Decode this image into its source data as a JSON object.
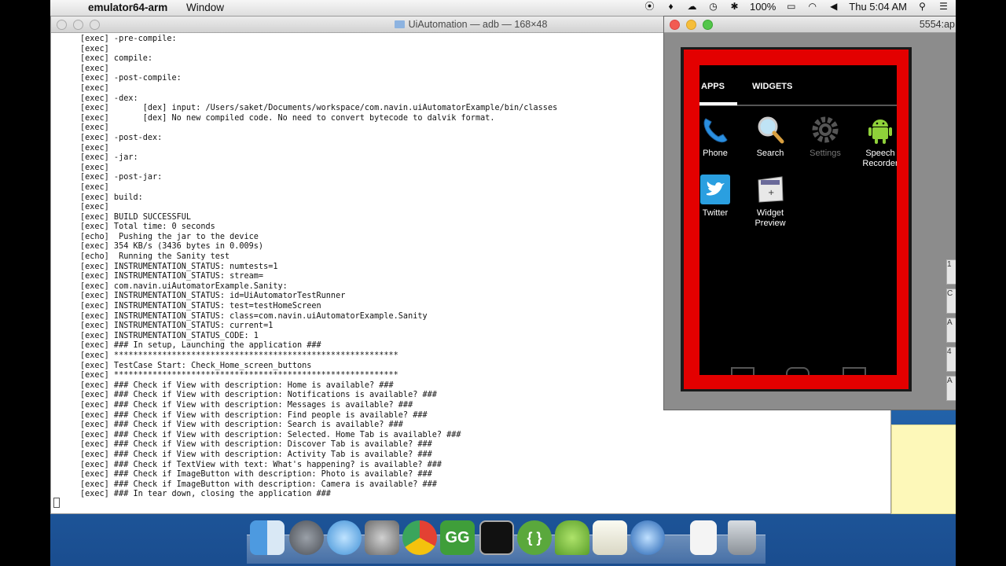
{
  "menubar": {
    "app_name": "emulator64-arm",
    "menu_window": "Window",
    "battery": "100%",
    "clock": "Thu 5:04 AM"
  },
  "terminal": {
    "title": "UiAutomation — adb — 168×48",
    "log": [
      "[exec] -pre-compile:",
      "[exec]",
      "[exec] compile:",
      "[exec]",
      "[exec] -post-compile:",
      "[exec]",
      "[exec] -dex:",
      "[exec]       [dex] input: /Users/saket/Documents/workspace/com.navin.uiAutomatorExample/bin/classes",
      "[exec]       [dex] No new compiled code. No need to convert bytecode to dalvik format.",
      "[exec]",
      "[exec] -post-dex:",
      "[exec]",
      "[exec] -jar:",
      "[exec]",
      "[exec] -post-jar:",
      "[exec]",
      "[exec] build:",
      "[exec]",
      "[exec] BUILD SUCCESSFUL",
      "[exec] Total time: 0 seconds",
      "[echo]  Pushing the jar to the device",
      "[exec] 354 KB/s (3436 bytes in 0.009s)",
      "[echo]  Running the Sanity test",
      "[exec] INSTRUMENTATION_STATUS: numtests=1",
      "[exec] INSTRUMENTATION_STATUS: stream=",
      "[exec] com.navin.uiAutomatorExample.Sanity:",
      "[exec] INSTRUMENTATION_STATUS: id=UiAutomatorTestRunner",
      "[exec] INSTRUMENTATION_STATUS: test=testHomeScreen",
      "[exec] INSTRUMENTATION_STATUS: class=com.navin.uiAutomatorExample.Sanity",
      "[exec] INSTRUMENTATION_STATUS: current=1",
      "[exec] INSTRUMENTATION_STATUS_CODE: 1",
      "[exec] ### In setup, Launching the application ###",
      "[exec] ***********************************************************",
      "[exec] TestCase Start: Check_Home_screen_buttons",
      "[exec] ***********************************************************",
      "[exec] ### Check if View with description: Home is available? ###",
      "[exec] ### Check if View with description: Notifications is available? ###",
      "[exec] ### Check if View with description: Messages is available? ###",
      "[exec] ### Check if View with description: Find people is available? ###",
      "[exec] ### Check if View with description: Search is available? ###",
      "[exec] ### Check if View with description: Selected. Home Tab is available? ###",
      "[exec] ### Check if View with description: Discover Tab is available? ###",
      "[exec] ### Check if View with description: Activity Tab is available? ###",
      "[exec] ### Check if TextView with text: What's happening? is available? ###",
      "[exec] ### Check if ImageButton with description: Photo is available? ###",
      "[exec] ### Check if ImageButton with description: Camera is available? ###",
      "[exec] ### In tear down, closing the application ###"
    ]
  },
  "emulator": {
    "title": "5554:ap",
    "tabs": {
      "apps": "APPS",
      "widgets": "WIDGETS"
    },
    "apps": [
      {
        "label": "Phone",
        "icon": "phone-icon"
      },
      {
        "label": "Search",
        "icon": "search-icon"
      },
      {
        "label": "Settings",
        "icon": "settings-icon"
      },
      {
        "label": "Speech Recorder",
        "icon": "android-icon"
      },
      {
        "label": "Twitter",
        "icon": "twitter-icon"
      },
      {
        "label": "Widget Preview",
        "icon": "widget-preview-icon"
      }
    ]
  },
  "side_buttons": [
    "1",
    "C",
    "A",
    "4",
    "A"
  ],
  "dock": [
    "finder-icon",
    "launchpad-icon",
    "messages-icon",
    "system-preferences-icon",
    "chrome-icon",
    "gg-icon",
    "terminal-icon",
    "brackets-icon",
    "android-icon",
    "textedit-icon",
    "quicktime-icon",
    "document-icon",
    "trash-icon"
  ],
  "dock_labels": {
    "gg": "GG",
    "brackets": "{ }"
  },
  "colors": {
    "emulator_frame_red": "#e30000",
    "dock_gradient_top": "#1c5ea6"
  }
}
